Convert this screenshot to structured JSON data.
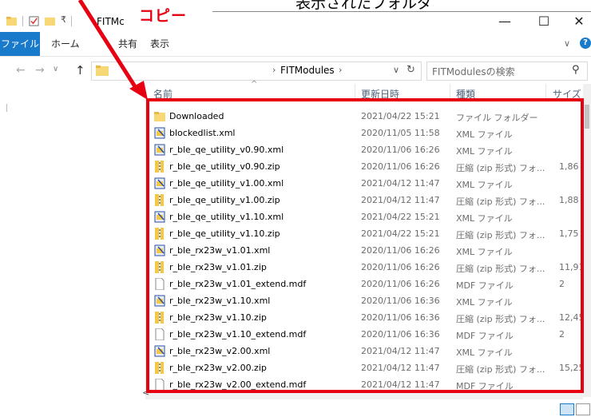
{
  "annotations": {
    "copy_label": "コピー",
    "displayed_folder_label": "表示されたフォルダ",
    "arrow_color": "#e60012",
    "highlight_color": "#e60012"
  },
  "window": {
    "title": "FITMc",
    "minimize": "—",
    "maximize": "☐",
    "close": "✕"
  },
  "ribbon": {
    "tabs": [
      "ファイル",
      "ホーム",
      "共有",
      "表示"
    ],
    "expand_chevron": "∨",
    "help": "?"
  },
  "address": {
    "back": "←",
    "forward": "→",
    "history": "∨",
    "up": "↑",
    "breadcrumb_sep": "›",
    "current_folder": "FITModules",
    "breadcrumb_end": "›",
    "dropdown": "∨",
    "refresh": "↻",
    "search_placeholder": "FITModulesの検索",
    "search_icon": "⚲"
  },
  "columns": {
    "name": "名前",
    "date": "更新日時",
    "type": "種類",
    "size": "サイズ",
    "sort_indicator": "^"
  },
  "files": [
    {
      "name": "Downloaded",
      "date": "2021/04/22 15:21",
      "type": "ファイル フォルダー",
      "size": "",
      "icon": "folder"
    },
    {
      "name": "blockedlist.xml",
      "date": "2020/11/05 11:58",
      "type": "XML ファイル",
      "size": "",
      "icon": "xml"
    },
    {
      "name": "r_ble_qe_utility_v0.90.xml",
      "date": "2020/11/06 16:26",
      "type": "XML ファイル",
      "size": "",
      "icon": "xml"
    },
    {
      "name": "r_ble_qe_utility_v0.90.zip",
      "date": "2020/11/06 16:26",
      "type": "圧縮 (zip 形式) フォ...",
      "size": "1,86",
      "icon": "zip"
    },
    {
      "name": "r_ble_qe_utility_v1.00.xml",
      "date": "2021/04/12 11:47",
      "type": "XML ファイル",
      "size": "",
      "icon": "xml"
    },
    {
      "name": "r_ble_qe_utility_v1.00.zip",
      "date": "2021/04/12 11:47",
      "type": "圧縮 (zip 形式) フォ...",
      "size": "1,88",
      "icon": "zip"
    },
    {
      "name": "r_ble_qe_utility_v1.10.xml",
      "date": "2021/04/22 15:21",
      "type": "XML ファイル",
      "size": "",
      "icon": "xml"
    },
    {
      "name": "r_ble_qe_utility_v1.10.zip",
      "date": "2021/04/22 15:21",
      "type": "圧縮 (zip 形式) フォ...",
      "size": "1,75",
      "icon": "zip"
    },
    {
      "name": "r_ble_rx23w_v1.01.xml",
      "date": "2020/11/06 16:26",
      "type": "XML ファイル",
      "size": "",
      "icon": "xml"
    },
    {
      "name": "r_ble_rx23w_v1.01.zip",
      "date": "2020/11/06 16:26",
      "type": "圧縮 (zip 形式) フォ...",
      "size": "11,91",
      "icon": "zip"
    },
    {
      "name": "r_ble_rx23w_v1.01_extend.mdf",
      "date": "2020/11/06 16:26",
      "type": "MDF ファイル",
      "size": "2",
      "icon": "file"
    },
    {
      "name": "r_ble_rx23w_v1.10.xml",
      "date": "2020/11/06 16:36",
      "type": "XML ファイル",
      "size": "",
      "icon": "xml"
    },
    {
      "name": "r_ble_rx23w_v1.10.zip",
      "date": "2020/11/06 16:36",
      "type": "圧縮 (zip 形式) フォ...",
      "size": "12,45",
      "icon": "zip"
    },
    {
      "name": "r_ble_rx23w_v1.10_extend.mdf",
      "date": "2020/11/06 16:36",
      "type": "MDF ファイル",
      "size": "2",
      "icon": "file"
    },
    {
      "name": "r_ble_rx23w_v2.00.xml",
      "date": "2021/04/12 11:47",
      "type": "XML ファイル",
      "size": "",
      "icon": "xml"
    },
    {
      "name": "r_ble_rx23w_v2.00.zip",
      "date": "2021/04/12 11:47",
      "type": "圧縮 (zip 形式) フォ...",
      "size": "15,25",
      "icon": "zip"
    },
    {
      "name": "r_ble_rx23w_v2.00_extend.mdf",
      "date": "2021/04/12 11:47",
      "type": "MDF ファイル",
      "size": "",
      "icon": "file"
    }
  ],
  "scroll": {
    "left_arrow": "<",
    "right_arrow": ">",
    "up_arrow": "^",
    "down_arrow": "v"
  },
  "colors": {
    "accent": "#1979ca",
    "folder": "#f8d775",
    "xml_blue": "#2b4f9c",
    "zip_yellow": "#f3c846",
    "header_text": "#4c607a"
  }
}
